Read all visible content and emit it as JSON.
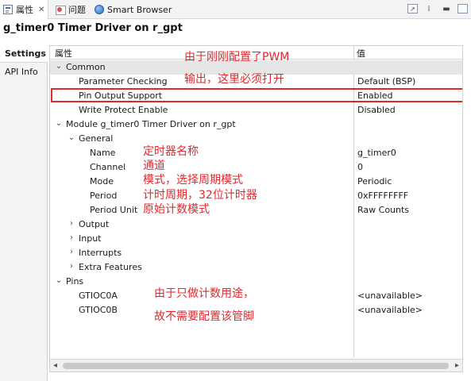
{
  "tabs": [
    {
      "label": "属性",
      "active": true
    },
    {
      "label": "问题"
    },
    {
      "label": "Smart Browser"
    }
  ],
  "title": "g_timer0 Timer Driver on r_gpt",
  "left_tabs": [
    "Settings",
    "API Info"
  ],
  "table": {
    "col_property": "属性",
    "col_value": "值",
    "rows": [
      {
        "name": "Common",
        "value": "",
        "toggle": "⌄"
      },
      {
        "name": "Parameter Checking",
        "value": "Default (BSP)"
      },
      {
        "name": "Pin Output Support",
        "value": "Enabled"
      },
      {
        "name": "Write Protect Enable",
        "value": "Disabled"
      },
      {
        "name": "Module g_timer0 Timer Driver on r_gpt",
        "value": "",
        "toggle": "⌄"
      },
      {
        "name": "General",
        "value": "",
        "toggle": "⌄"
      },
      {
        "name": "Name",
        "value": "g_timer0"
      },
      {
        "name": "Channel",
        "value": "0"
      },
      {
        "name": "Mode",
        "value": "Periodic"
      },
      {
        "name": "Period",
        "value": "0xFFFFFFFF"
      },
      {
        "name": "Period Unit",
        "value": "Raw Counts"
      },
      {
        "name": "Output",
        "value": "",
        "toggle": "›"
      },
      {
        "name": "Input",
        "value": "",
        "toggle": "›"
      },
      {
        "name": "Interrupts",
        "value": "",
        "toggle": "›"
      },
      {
        "name": "Extra Features",
        "value": "",
        "toggle": "›"
      },
      {
        "name": "Pins",
        "value": "",
        "toggle": "⌄"
      },
      {
        "name": "GTIOC0A",
        "value": "<unavailable>"
      },
      {
        "name": "GTIOC0B",
        "value": "<unavailable>"
      }
    ]
  },
  "annotations": {
    "pwm_line1": "由于刚刚配置了PWM",
    "pwm_line2": "输出，这里必须打开",
    "name_note": "定时器名称",
    "channel_note": "通道",
    "mode_note": "模式，选择周期模式",
    "period_note": "计时周期，32位计时器",
    "unit_note": "原始计数模式",
    "pins_line1": "由于只做计数用途，",
    "pins_line2": "故不需要配置该管脚"
  },
  "colors": {
    "annotation": "#e0282e",
    "highlight_border": "#e0282e",
    "selected_row": "#e6e6e6"
  }
}
